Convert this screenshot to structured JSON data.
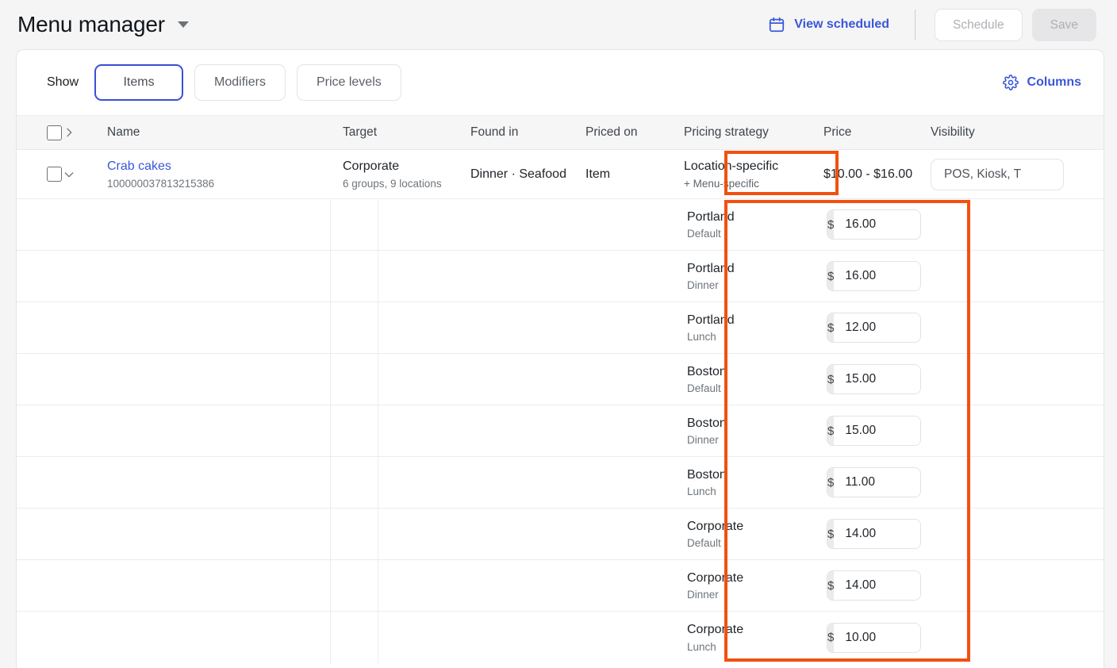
{
  "header": {
    "title": "Menu manager",
    "dropdown_icon": "caret-down-icon",
    "view_scheduled": "View scheduled",
    "calendar_icon": "calendar-icon",
    "schedule_button": "Schedule",
    "save_button": "Save"
  },
  "toolbar": {
    "show_label": "Show",
    "tabs": [
      {
        "label": "Items",
        "active": true
      },
      {
        "label": "Modifiers",
        "active": false
      },
      {
        "label": "Price levels",
        "active": false
      }
    ],
    "columns_label": "Columns",
    "gear_icon": "gear-icon"
  },
  "table": {
    "headers": {
      "expand_icon": "chevron-right-icon",
      "name": "Name",
      "target": "Target",
      "found_in": "Found in",
      "priced_on": "Priced on",
      "pricing_strategy": "Pricing strategy",
      "price": "Price",
      "visibility": "Visibility"
    },
    "row": {
      "expand_icon": "chevron-down-icon",
      "name": "Crab cakes",
      "id": "100000037813215386",
      "target_main": "Corporate",
      "target_meta": "6 groups, 9 locations",
      "found_in": "Dinner · Seafood",
      "priced_on": "Item",
      "pricing_strategy_main": "Location-specific",
      "pricing_strategy_sub": "+ Menu-specific",
      "price_range": "$10.00 - $16.00",
      "visibility": "POS, Kiosk, T"
    },
    "price_rows": [
      {
        "location": "Portland",
        "level": "Default",
        "currency": "$",
        "amount": "16.00"
      },
      {
        "location": "Portland",
        "level": "Dinner",
        "currency": "$",
        "amount": "16.00"
      },
      {
        "location": "Portland",
        "level": "Lunch",
        "currency": "$",
        "amount": "12.00"
      },
      {
        "location": "Boston",
        "level": "Default",
        "currency": "$",
        "amount": "15.00"
      },
      {
        "location": "Boston",
        "level": "Dinner",
        "currency": "$",
        "amount": "15.00"
      },
      {
        "location": "Boston",
        "level": "Lunch",
        "currency": "$",
        "amount": "11.00"
      },
      {
        "location": "Corporate",
        "level": "Default",
        "currency": "$",
        "amount": "14.00"
      },
      {
        "location": "Corporate",
        "level": "Dinner",
        "currency": "$",
        "amount": "14.00"
      },
      {
        "location": "Corporate",
        "level": "Lunch",
        "currency": "$",
        "amount": "10.00"
      }
    ]
  },
  "annotations": {
    "highlight_color": "#f2500f",
    "accent_blue": "#3a57d8"
  }
}
